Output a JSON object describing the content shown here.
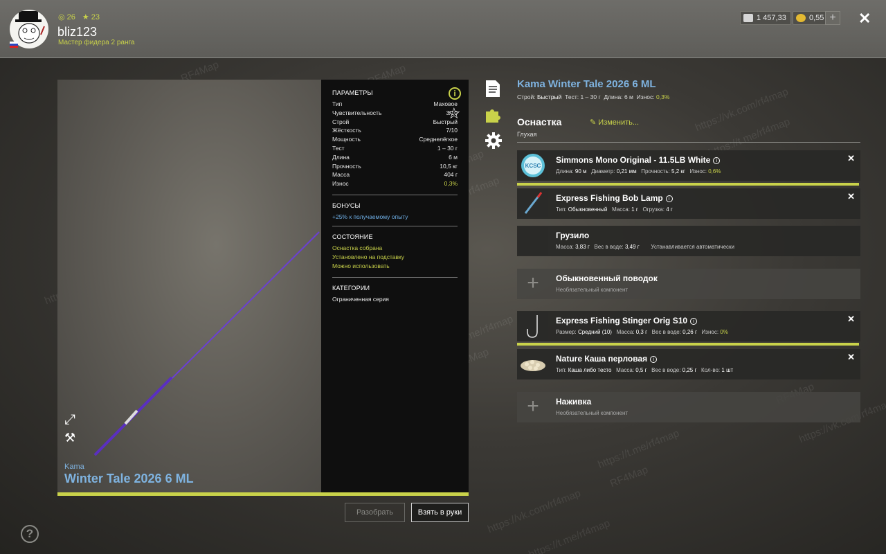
{
  "header": {
    "silver_stat": "26",
    "gold_stat": "23",
    "username": "bliz123",
    "rank": "Мастер фидера 2 ранга",
    "silver_money": "1 457,33",
    "gold_money": "0,55",
    "add_label": "+",
    "close_label": "✕"
  },
  "rod": {
    "brand": "Kama",
    "name": "Winter Tale 2026 6 ML",
    "full_title": "Kama Winter Tale 2026 6 ML",
    "subtitle_parts": {
      "build_label": "Строй:",
      "build": "Быстрый",
      "test_label": "Тест:",
      "test": "1 – 30 г",
      "length_label": "Длина:",
      "length": "6 м",
      "wear_label": "Износ:",
      "wear": "0,3%"
    },
    "params_title": "ПАРАМЕТРЫ",
    "params": [
      {
        "k": "Тип",
        "v": "Маховое"
      },
      {
        "k": "Чувствительность",
        "v": "3/10"
      },
      {
        "k": "Строй",
        "v": "Быстрый"
      },
      {
        "k": "Жёсткость",
        "v": "7/10"
      },
      {
        "k": "Мощность",
        "v": "Среднелёгкое"
      },
      {
        "k": "Тест",
        "v": "1 – 30 г"
      },
      {
        "k": "Длина",
        "v": "6 м"
      },
      {
        "k": "Прочность",
        "v": "10,5 кг"
      },
      {
        "k": "Масса",
        "v": "404 г"
      },
      {
        "k": "Износ",
        "v": "0,3%"
      }
    ],
    "bonus_title": "БОНУСЫ",
    "bonus": "+25% к получаемому опыту",
    "state_title": "СОСТОЯНИЕ",
    "states": [
      "Оснастка собрана",
      "Установлено на подставку",
      "Можно использовать"
    ],
    "category_title": "КАТЕГОРИИ",
    "category": "Ограниченная серия"
  },
  "buttons": {
    "disassemble": "Разобрать",
    "take": "Взять в руки",
    "help": "?"
  },
  "tackle": {
    "title": "Оснастка",
    "change": "Изменить...",
    "type": "Глухая",
    "slots": [
      {
        "name": "Simmons Mono Original - 11.5LB White",
        "det": [
          [
            "Длина:",
            "90 м"
          ],
          [
            "Диаметр:",
            "0,21 мм"
          ],
          [
            "Прочность:",
            "5,2 кг"
          ],
          [
            "Износ:",
            "0,6%"
          ]
        ],
        "thumb": "line-spool-icon",
        "removable": true,
        "bar": true
      },
      {
        "name": "Express Fishing Bob Lamp",
        "det": [
          [
            "Тип:",
            "Обыкновенный"
          ],
          [
            "Масса:",
            "1 г"
          ],
          [
            "Огрузка:",
            "4 г"
          ]
        ],
        "thumb": "float-icon",
        "removable": true,
        "bar": false
      },
      {
        "name": "Грузило",
        "det": [
          [
            "Масса:",
            "3,83 г"
          ],
          [
            "Вес в воде:",
            "3,49 г"
          ]
        ],
        "extra": "Устанавливается автоматически",
        "thumb": "",
        "removable": false,
        "bar": false,
        "noinfo": true
      },
      {
        "name": "Обыкновенный поводок",
        "empty_text": "Необязательный компонент",
        "thumb": "plus-icon",
        "empty": true
      },
      {
        "name": "Express Fishing Stinger Orig S10",
        "det": [
          [
            "Размер:",
            "Средний (10)"
          ],
          [
            "Масса:",
            "0,3 г"
          ],
          [
            "Вес в воде:",
            "0,26 г"
          ],
          [
            "Износ:",
            "0%"
          ]
        ],
        "thumb": "hook-icon",
        "removable": true,
        "bar": true
      },
      {
        "name": "Nature Каша перловая",
        "det": [
          [
            "Тип:",
            "Каша либо тесто"
          ],
          [
            "Масса:",
            "0,5 г"
          ],
          [
            "Вес в воде:",
            "0,25 г"
          ],
          [
            "Кол-во:",
            "1 шт"
          ]
        ],
        "thumb": "porridge-icon",
        "removable": true,
        "bar": false
      },
      {
        "name": "Наживка",
        "empty_text": "Необязательный компонент",
        "thumb": "plus-icon",
        "empty": true
      }
    ]
  },
  "watermarks": [
    "RF4Map",
    "https://vk.com/rf4map",
    "https://t.me/rf4map"
  ],
  "colors": {
    "accent": "#c9d24a",
    "title_blue": "#7fb3e0",
    "rod_purple": "#6b3fd4"
  }
}
